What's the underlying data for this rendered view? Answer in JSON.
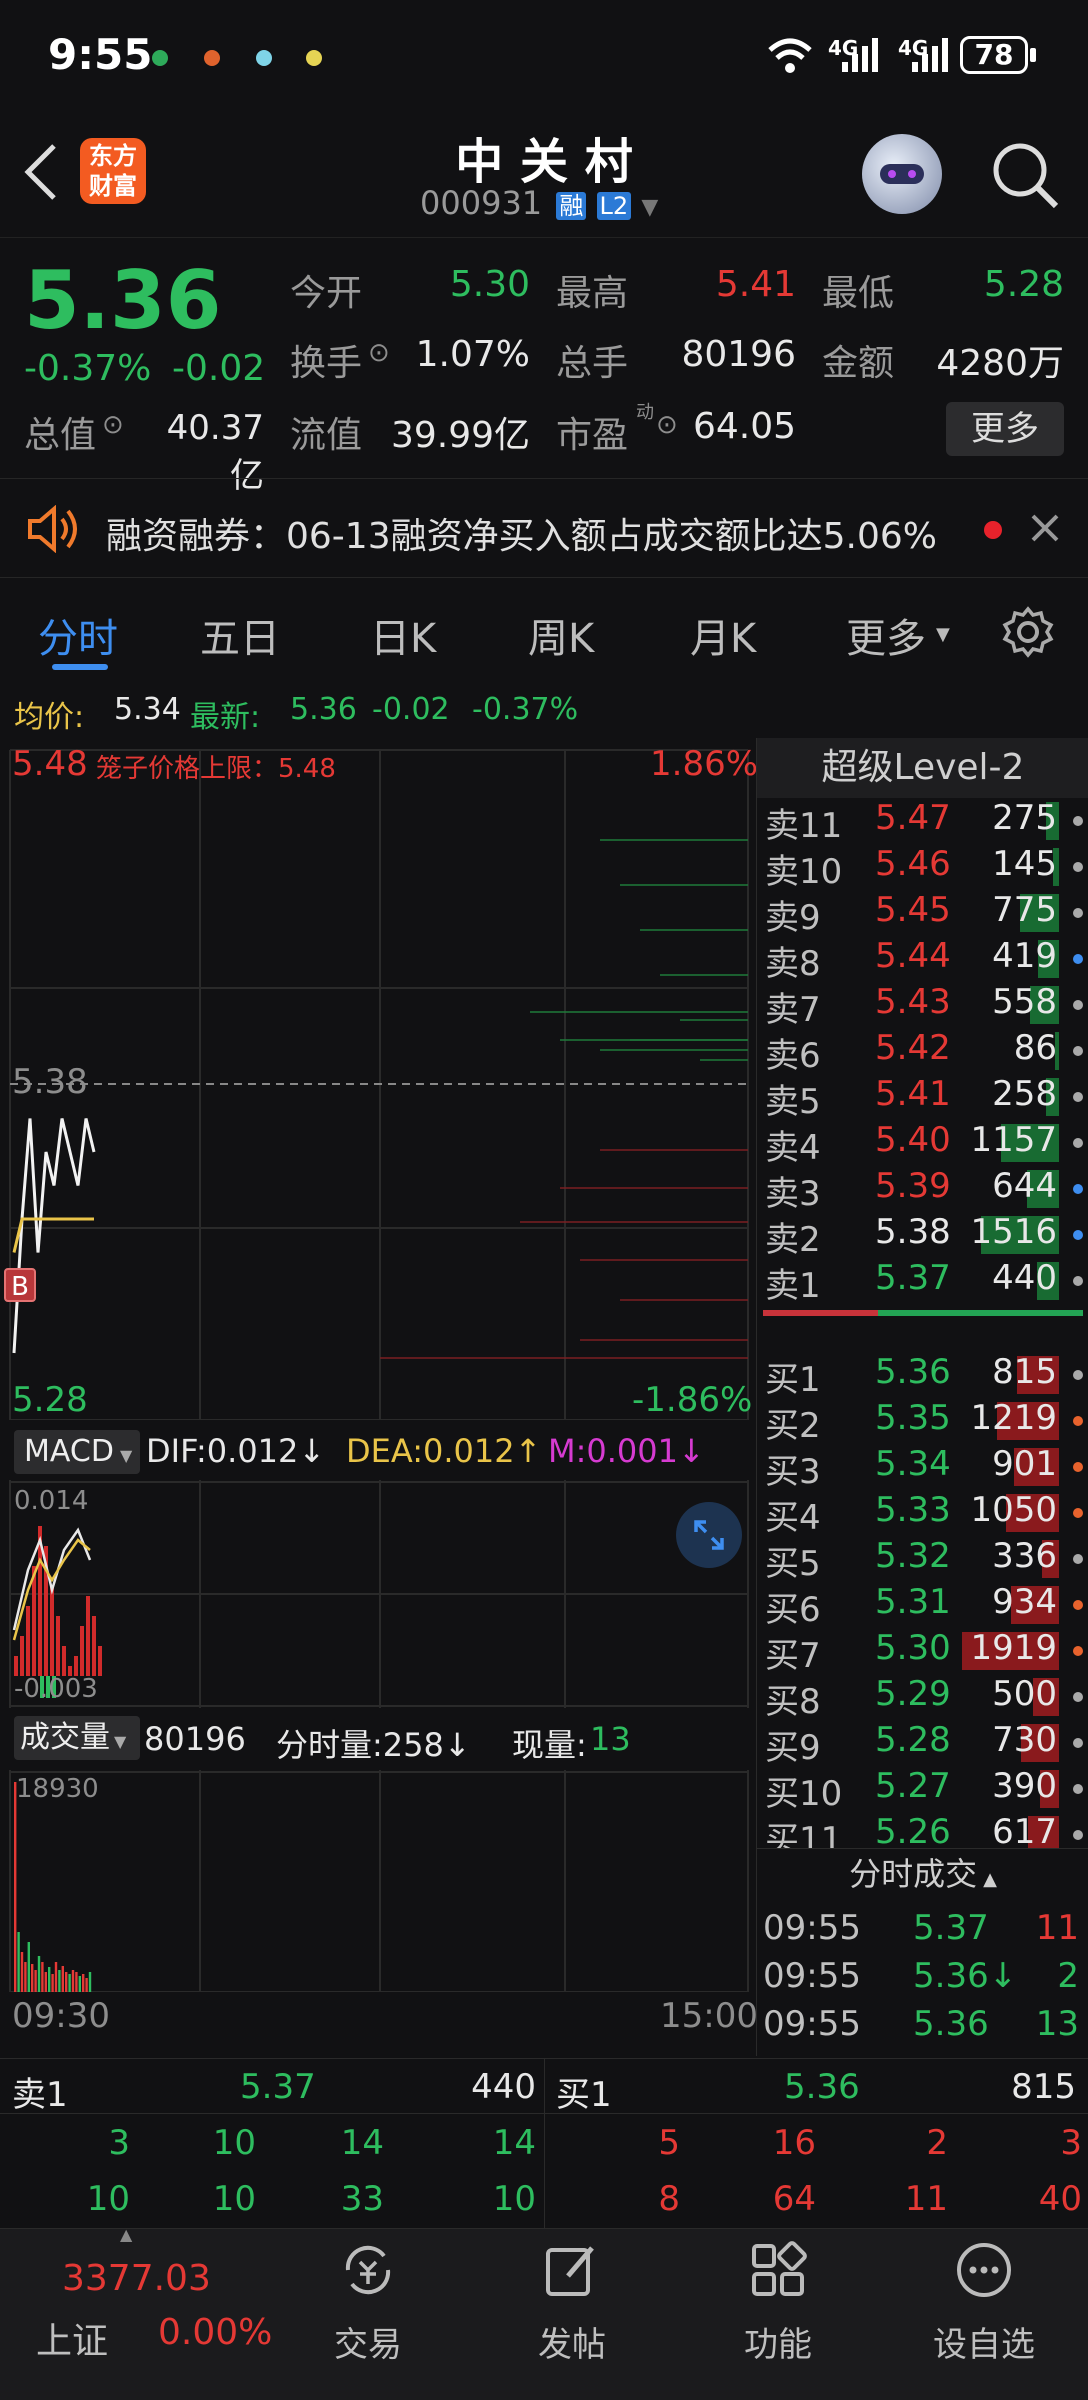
{
  "status": {
    "time": "9:55",
    "battery": "78",
    "net1": "4G",
    "net2": "4G"
  },
  "header": {
    "logo_line1": "东方",
    "logo_line2": "财富",
    "name": "中 关 村",
    "code": "000931",
    "badge1": "融",
    "badge2": "L2"
  },
  "quote": {
    "price": "5.36",
    "pct": "-0.37%",
    "chg": "-0.02",
    "open_lbl": "今开",
    "open": "5.30",
    "high_lbl": "最高",
    "high": "5.41",
    "low_lbl": "最低",
    "low": "5.28",
    "turnover_lbl": "换手",
    "turnover": "1.07%",
    "vol_lbl": "总手",
    "vol": "80196",
    "amount_lbl": "金额",
    "amount": "4280万",
    "mcap_lbl": "总值",
    "mcap": "40.37亿",
    "float_lbl": "流值",
    "float": "39.99亿",
    "pe_lbl": "市盈",
    "pe_sup": "动",
    "pe": "64.05",
    "more": "更多"
  },
  "notice": {
    "text": "融资融券：06-13融资净买入额占成交额比达5.06%"
  },
  "tabs": [
    "分时",
    "五日",
    "日K",
    "周K",
    "月K",
    "更多"
  ],
  "avg": {
    "avg_lbl": "均价:",
    "avg": "5.34",
    "last_lbl": "最新:",
    "last": "5.36",
    "chg": "-0.02",
    "pct": "-0.37%"
  },
  "chart": {
    "top_price": "5.48",
    "limit_text": "笼子价格上限：5.48",
    "top_pct": "1.86%",
    "mid_price": "5.38",
    "bottom_price": "5.28",
    "bottom_pct": "-1.86%",
    "b_marker": "B",
    "macd_lbl": "MACD",
    "dif": "DIF:0.012↓",
    "dea": "DEA:0.012↑",
    "macd_m": "M:0.001↓",
    "macd_top": "0.014",
    "macd_bottom": "-0.003",
    "vol_lbl": "成交量",
    "vol_total": "80196",
    "vol_min": "分时量:258↓",
    "vol_now_lbl": "现量:",
    "vol_now": "13",
    "vol_max": "18930",
    "time_start": "09:30",
    "time_end": "15:00"
  },
  "chart_data": {
    "type": "line",
    "ylim": [
      5.28,
      5.48
    ],
    "series": [
      {
        "values": [
          5.3,
          5.34,
          5.37,
          5.33,
          5.36,
          5.35,
          5.37,
          5.36,
          5.35,
          5.37,
          5.36
        ]
      },
      {
        "values": [
          5.33,
          5.34,
          5.34,
          5.34,
          5.34,
          5.34,
          5.34,
          5.34,
          5.34,
          5.34,
          5.34
        ]
      }
    ]
  },
  "book": {
    "title": "超级Level-2",
    "asks": [
      {
        "lbl": "卖11",
        "price": "5.47",
        "vol": "275",
        "bar": 0.1
      },
      {
        "lbl": "卖10",
        "price": "5.46",
        "vol": "145",
        "bar": 0.05
      },
      {
        "lbl": "卖9",
        "price": "5.45",
        "vol": "775",
        "bar": 0.3
      },
      {
        "lbl": "卖8",
        "price": "5.44",
        "vol": "419",
        "bar": 0.16
      },
      {
        "lbl": "卖7",
        "price": "5.43",
        "vol": "558",
        "bar": 0.22
      },
      {
        "lbl": "卖6",
        "price": "5.42",
        "vol": "86",
        "bar": 0.03
      },
      {
        "lbl": "卖5",
        "price": "5.41",
        "vol": "258",
        "bar": 0.1
      },
      {
        "lbl": "卖4",
        "price": "5.40",
        "vol": "1157",
        "bar": 0.45
      },
      {
        "lbl": "卖3",
        "price": "5.39",
        "vol": "644",
        "bar": 0.25
      },
      {
        "lbl": "卖2",
        "price": "5.38",
        "vol": "1516",
        "bar": 0.6
      },
      {
        "lbl": "卖1",
        "price": "5.37",
        "vol": "440",
        "bar": 0.17
      }
    ],
    "bids": [
      {
        "lbl": "买1",
        "price": "5.36",
        "vol": "815",
        "bar": 0.32
      },
      {
        "lbl": "买2",
        "price": "5.35",
        "vol": "1219",
        "bar": 0.48
      },
      {
        "lbl": "买3",
        "price": "5.34",
        "vol": "901",
        "bar": 0.35
      },
      {
        "lbl": "买4",
        "price": "5.33",
        "vol": "1050",
        "bar": 0.41
      },
      {
        "lbl": "买5",
        "price": "5.32",
        "vol": "336",
        "bar": 0.13
      },
      {
        "lbl": "买6",
        "price": "5.31",
        "vol": "934",
        "bar": 0.37
      },
      {
        "lbl": "买7",
        "price": "5.30",
        "vol": "1919",
        "bar": 0.75
      },
      {
        "lbl": "买8",
        "price": "5.29",
        "vol": "500",
        "bar": 0.2
      },
      {
        "lbl": "买9",
        "price": "5.28",
        "vol": "730",
        "bar": 0.29
      },
      {
        "lbl": "买10",
        "price": "5.27",
        "vol": "390",
        "bar": 0.15
      },
      {
        "lbl": "买11",
        "price": "5.26",
        "vol": "617",
        "bar": 0.24
      }
    ]
  },
  "ticks": {
    "title": "分时成交",
    "rows": [
      {
        "time": "09:55",
        "price": "5.37",
        "vol": "11"
      },
      {
        "time": "09:55",
        "price": "5.36↓",
        "vol": "2"
      },
      {
        "time": "09:55",
        "price": "5.36",
        "vol": "13"
      }
    ]
  },
  "queue": {
    "ask_lbl": "卖1",
    "ask_price": "5.37",
    "ask_vol": "440",
    "bid_lbl": "买1",
    "bid_price": "5.36",
    "bid_vol": "815",
    "ask_row1": [
      "3",
      "10",
      "14",
      "14"
    ],
    "ask_row2": [
      "10",
      "10",
      "33",
      "10"
    ],
    "bid_row1": [
      "5",
      "16",
      "2",
      "3"
    ],
    "bid_row2": [
      "8",
      "64",
      "11",
      "40"
    ]
  },
  "nav": {
    "index_value": "3377.03",
    "index_name": "上证",
    "index_pct": "0.00%",
    "trade": "交易",
    "post": "发帖",
    "func": "功能",
    "watch": "设自选"
  }
}
